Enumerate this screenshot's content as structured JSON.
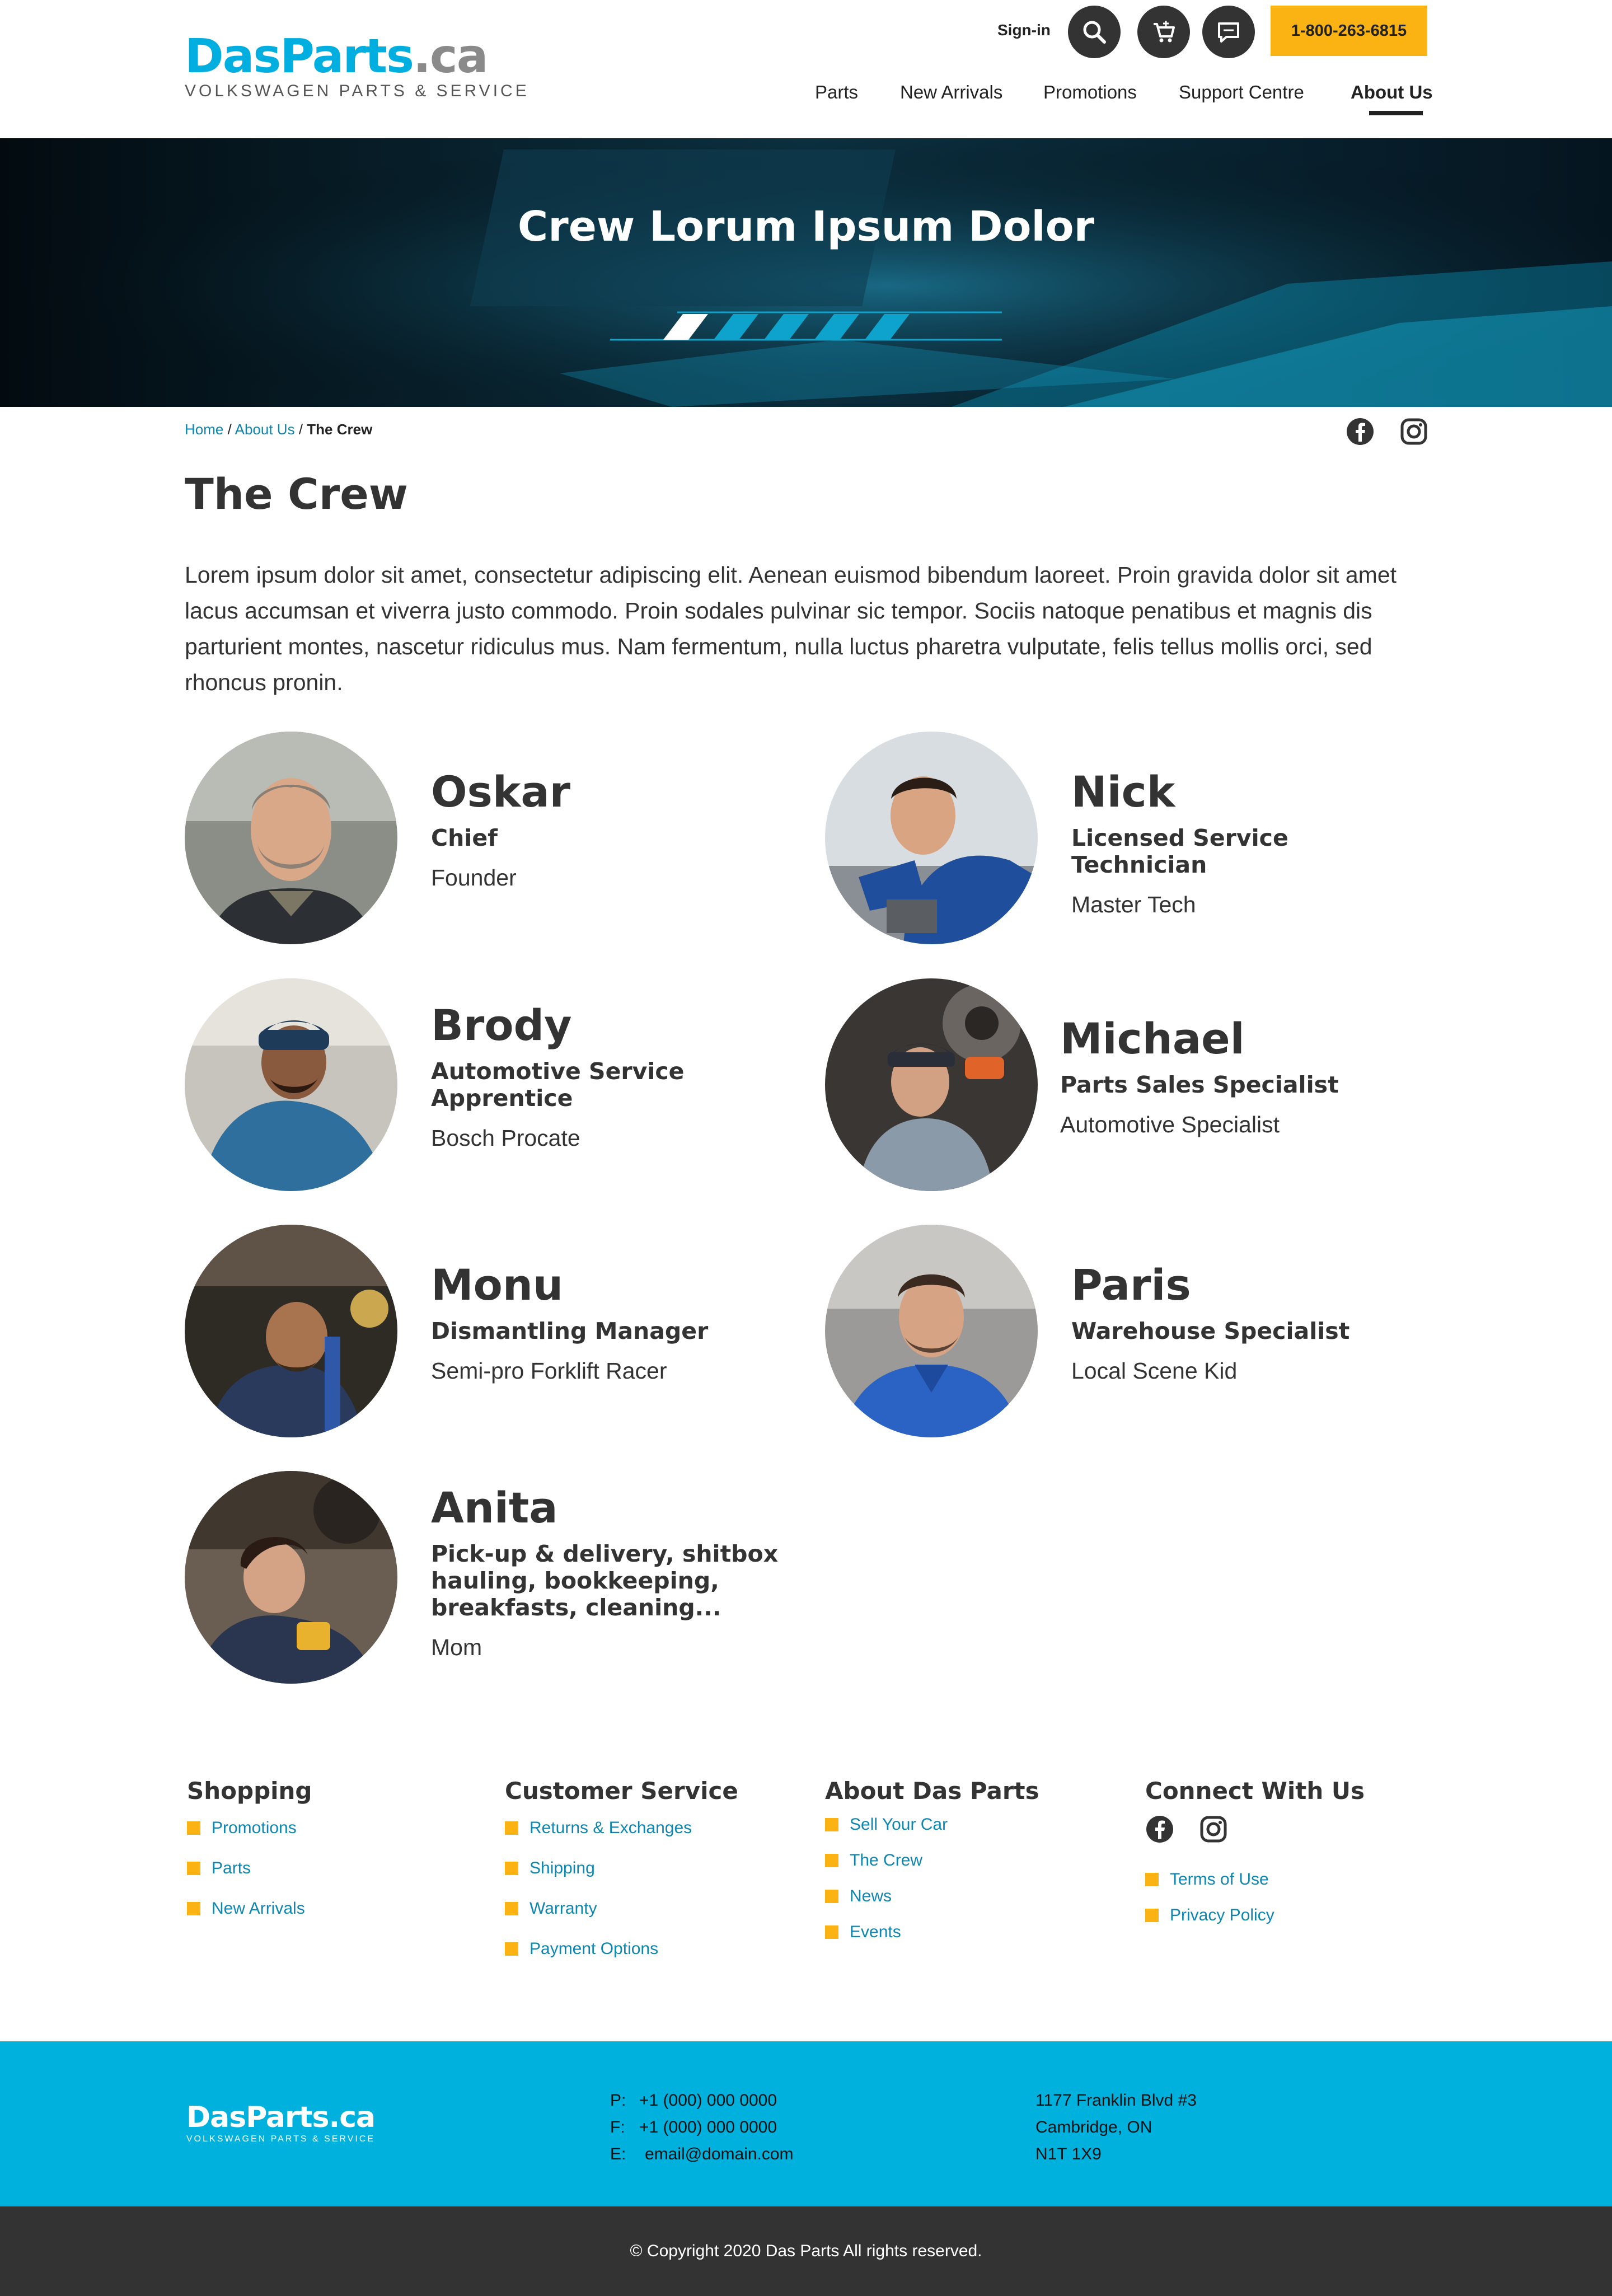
{
  "brand": {
    "name_main": "DasParts",
    "name_suffix": ".ca",
    "tagline": "VOLKSWAGEN PARTS & SERVICE",
    "accent": "#00aee0",
    "yellow": "#fbb313",
    "dark": "#333333"
  },
  "header": {
    "signin_label": "Sign-in",
    "icons": [
      "search-icon",
      "cart-icon",
      "chat-icon"
    ],
    "phone": "1-800-263-6815"
  },
  "nav": {
    "items": [
      "Parts",
      "New Arrivals",
      "Promotions",
      "Support Centre",
      "About Us"
    ],
    "active": "About Us"
  },
  "hero": {
    "title": "Crew Lorum Ipsum Dolor"
  },
  "breadcrumb": {
    "home": "Home",
    "about": "About Us",
    "current": "The Crew",
    "separator": "/"
  },
  "page": {
    "title": "The Crew",
    "intro": "Lorem ipsum dolor sit amet, consectetur adipiscing elit. Aenean euismod bibendum laoreet. Proin gravida dolor sit amet lacus accumsan et viverra justo commodo. Proin sodales pulvinar sic tempor. Sociis natoque penatibus et magnis dis parturient montes, nascetur ridiculus mus. Nam fermentum, nulla luctus pharetra vulputate, felis tellus mollis orci, sed rhoncus pronin."
  },
  "crew": [
    {
      "name": "Oskar",
      "role": "Chief",
      "subtitle": "Founder"
    },
    {
      "name": "Nick",
      "role": "Licensed Service Technician",
      "subtitle": "Master Tech"
    },
    {
      "name": "Brody",
      "role": "Automotive Service Apprentice",
      "subtitle": "Bosch Procate"
    },
    {
      "name": "Michael",
      "role": "Parts Sales Specialist",
      "subtitle": "Automotive Specialist"
    },
    {
      "name": "Monu",
      "role": "Dismantling Manager",
      "subtitle": "Semi-pro Forklift Racer"
    },
    {
      "name": "Paris",
      "role": "Warehouse Specialist",
      "subtitle": "Local Scene Kid"
    },
    {
      "name": "Anita",
      "role": "Pick-up & delivery, shitbox hauling, bookkeeping, breakfasts, cleaning...",
      "subtitle": "Mom"
    }
  ],
  "footer": {
    "shopping": {
      "title": "Shopping",
      "links": [
        "Promotions",
        "Parts",
        "New Arrivals"
      ]
    },
    "customer_service": {
      "title": "Customer Service",
      "links": [
        "Returns & Exchanges",
        "Shipping",
        "Warranty",
        "Payment Options"
      ]
    },
    "about": {
      "title": "About Das Parts",
      "links": [
        "Sell Your Car",
        "The Crew",
        "News",
        "Events"
      ]
    },
    "connect": {
      "title": "Connect With Us",
      "links": [
        "Terms of Use",
        "Privacy Policy"
      ]
    }
  },
  "contact": {
    "phone_label": "P:",
    "phone": "+1 (000) 000 0000",
    "fax_label": "F:",
    "fax": "+1 (000) 000 0000",
    "email_label": "E:",
    "email": "email@domain.com",
    "address_line1": "1177 Franklin Blvd #3",
    "address_line2": "Cambridge, ON",
    "address_line3": "N1T 1X9"
  },
  "copyright": "© Copyright 2020 Das Parts All rights reserved."
}
